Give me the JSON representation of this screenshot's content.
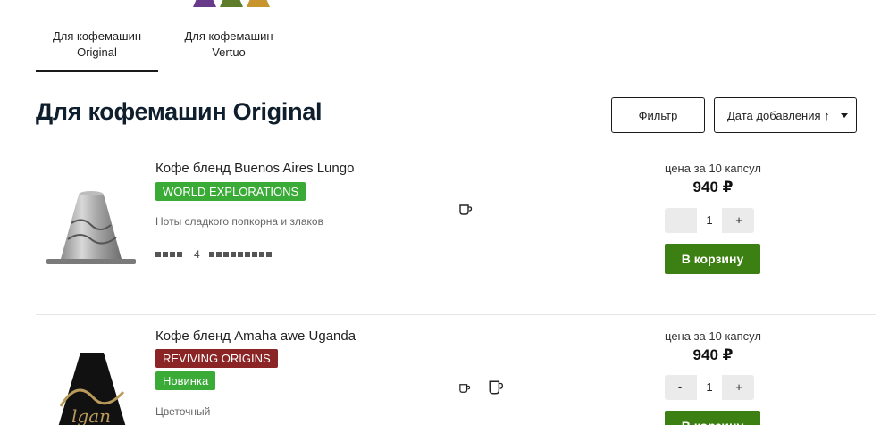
{
  "tabs": [
    {
      "label": "Для кофемашин Original",
      "active": true
    },
    {
      "label": "Для кофемашин Vertuo",
      "active": false
    }
  ],
  "page_title": "Для кофемашин Original",
  "toolbar": {
    "filter_label": "Фильтр",
    "sort_label": "Дата добавления ↑"
  },
  "products": [
    {
      "name": "Кофе бленд Buenos Aires Lungo",
      "badges": [
        {
          "label": "WORLD EXPLORATIONS",
          "color": "#3bab38"
        }
      ],
      "note": "Ноты сладкого попкорна и злаков",
      "intensity": "4",
      "cup_icons": [
        "cup-icon"
      ],
      "price_label": "цена за 10 капсул",
      "price": "940 ₽",
      "quantity": "1",
      "minus_label": "-",
      "plus_label": "+",
      "cart_label": "В корзину"
    },
    {
      "name": "Кофе бленд Amaha awe Uganda",
      "badges": [
        {
          "label": "REVIVING ORIGINS",
          "color": "#8b2525"
        },
        {
          "label": "Новинка",
          "color": "#3bab38"
        }
      ],
      "note": "Цветочный",
      "cup_icons": [
        "cup-icon",
        "mug-icon"
      ],
      "price_label": "цена за 10 капсул",
      "price": "940 ₽",
      "quantity": "1",
      "minus_label": "-",
      "plus_label": "+",
      "cart_label": "В корзину"
    }
  ],
  "colors": {
    "accent_green": "#3c7f12",
    "badge_green": "#3bab38",
    "badge_darkred": "#8b2525",
    "title": "#0f1e2d"
  }
}
